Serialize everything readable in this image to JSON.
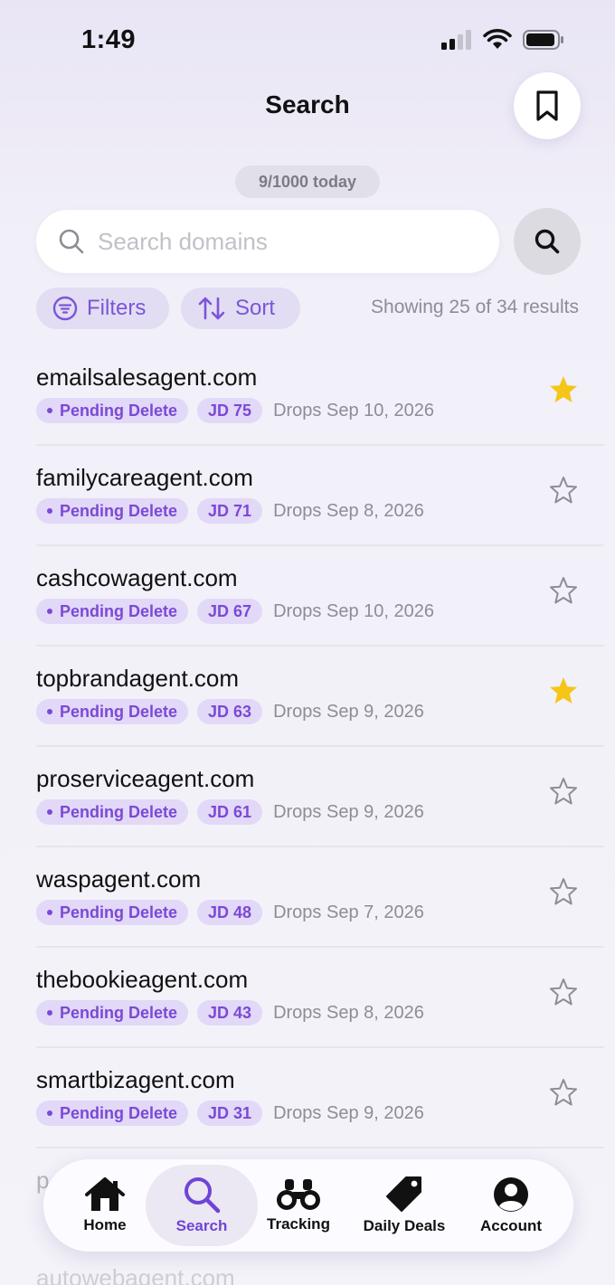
{
  "status_bar": {
    "time": "1:49"
  },
  "header": {
    "title": "Search"
  },
  "quota": "9/1000 today",
  "search": {
    "placeholder": "Search domains",
    "value": ""
  },
  "filters_label": "Filters",
  "sort_label": "Sort",
  "results_text": "Showing 25 of 34 results",
  "colors": {
    "accent": "#7b49d6",
    "star": "#f5c518",
    "badge_bg": "#e2d8f7"
  },
  "results": [
    {
      "domain": "emailsalesagent.com",
      "status": "Pending Delete",
      "jd": "JD 75",
      "drops": "Drops Sep 10, 2026",
      "starred": true
    },
    {
      "domain": "familycareagent.com",
      "status": "Pending Delete",
      "jd": "JD 71",
      "drops": "Drops Sep 8, 2026",
      "starred": false
    },
    {
      "domain": "cashcowagent.com",
      "status": "Pending Delete",
      "jd": "JD 67",
      "drops": "Drops Sep 10, 2026",
      "starred": false
    },
    {
      "domain": "topbrandagent.com",
      "status": "Pending Delete",
      "jd": "JD 63",
      "drops": "Drops Sep 9, 2026",
      "starred": true
    },
    {
      "domain": "proserviceagent.com",
      "status": "Pending Delete",
      "jd": "JD 61",
      "drops": "Drops Sep 9, 2026",
      "starred": false
    },
    {
      "domain": "waspagent.com",
      "status": "Pending Delete",
      "jd": "JD 48",
      "drops": "Drops Sep 7, 2026",
      "starred": false
    },
    {
      "domain": "thebookieagent.com",
      "status": "Pending Delete",
      "jd": "JD 43",
      "drops": "Drops Sep 8, 2026",
      "starred": false
    },
    {
      "domain": "smartbizagent.com",
      "status": "Pending Delete",
      "jd": "JD 31",
      "drops": "Drops Sep 9, 2026",
      "starred": false
    }
  ],
  "partial_rows": [
    "p",
    "autowebagent.com"
  ],
  "tabs": [
    {
      "label": "Home",
      "icon": "home-icon",
      "active": false
    },
    {
      "label": "Search",
      "icon": "search-icon",
      "active": true
    },
    {
      "label": "Tracking",
      "icon": "binoculars-icon",
      "active": false
    },
    {
      "label": "Daily Deals",
      "icon": "tag-icon",
      "active": false
    },
    {
      "label": "Account",
      "icon": "account-icon",
      "active": false
    }
  ]
}
